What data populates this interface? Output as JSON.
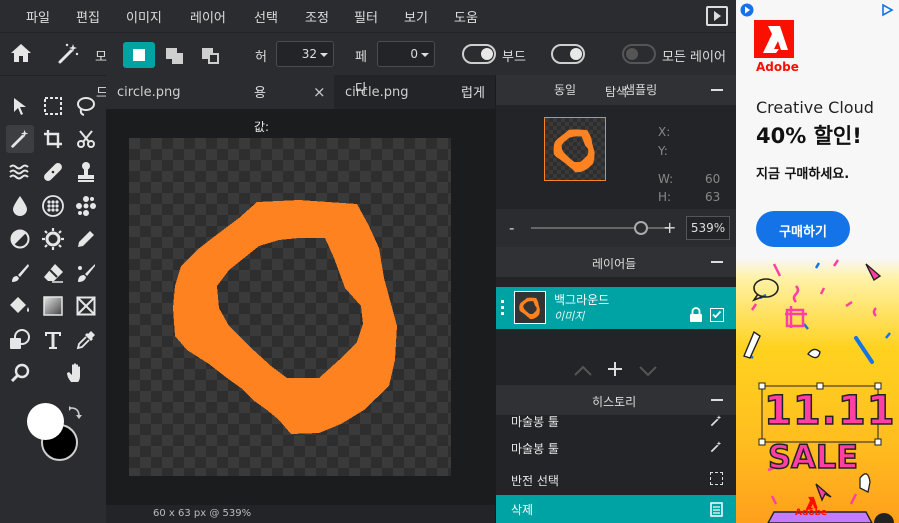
{
  "menubar": {
    "items": [
      "파일",
      "편집",
      "이미지",
      "레이어",
      "선택",
      "조정",
      "필터",
      "보기",
      "도움"
    ]
  },
  "optionsbar": {
    "mode_label": "모",
    "tolerance_label": "허",
    "tolerance_value": "32",
    "feather_label": "페",
    "feather_value": "0",
    "smooth_label": "부드",
    "all_layers_label": "모든 레이어"
  },
  "tabs": {
    "overlay_left": "드",
    "tab1": "circle.png",
    "tab1_overlay": "용",
    "tab2": "circle.png",
    "tab2_overlay": "다",
    "tab_overflow": "럽게",
    "popup_text": "값:"
  },
  "status": {
    "text": "60 x 63 px @ 539%"
  },
  "navigator": {
    "tab_left": "동일",
    "tab_mid": "탐색",
    "tab_right": "샘플링",
    "x_label": "X:",
    "y_label": "Y:",
    "w_label": "W:",
    "w_value": "60",
    "h_label": "H:",
    "h_value": "63",
    "zoom_minus": "-",
    "zoom_plus": "+",
    "zoom_value": "539%",
    "zoom_fraction": 0.8
  },
  "layers": {
    "title": "레이어들",
    "items": [
      {
        "name": "백그라운드",
        "type": "이미지"
      }
    ]
  },
  "history": {
    "title": "히스토리",
    "items": [
      "마술봉 툴",
      "마술봉 툴",
      "반전 선택",
      "삭제"
    ]
  },
  "ad": {
    "brand": "Adobe",
    "product": "Creative Cloud",
    "headline": "40% 할인!",
    "subline": "지금 구매하세요.",
    "button": "구매하기",
    "sale_number": "11.11",
    "sale_word": "SALE",
    "footer_brand": "Adobe"
  },
  "colors": {
    "accent": "#00a3a3",
    "orange": "#ff8221",
    "ad_yellow": "#ffd21f",
    "ad_blue": "#1473e6",
    "adobe_red": "#fa0f00"
  }
}
